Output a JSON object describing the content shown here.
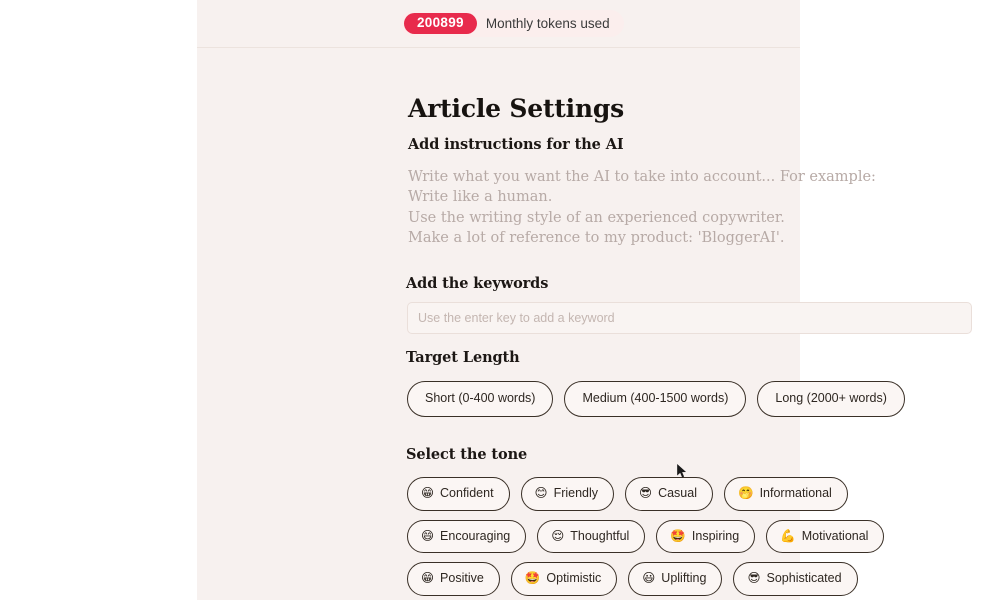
{
  "topbar": {
    "token_count": "200899",
    "token_label": "Monthly tokens used"
  },
  "page": {
    "title": "Article Settings"
  },
  "instructions": {
    "heading": "Add instructions for the AI",
    "placeholder_lines": [
      "Write what you want the AI to take into account... For example:",
      "Write like a human.",
      "Use the writing style of an experienced copywriter.",
      "Make a lot of reference to my product: 'BloggerAI'."
    ]
  },
  "keywords": {
    "heading": "Add the keywords",
    "placeholder": "Use the enter key to add a keyword",
    "value": ""
  },
  "target_length": {
    "heading": "Target Length",
    "options": [
      {
        "label": "Short (0-400 words)"
      },
      {
        "label": "Medium (400-1500 words)"
      },
      {
        "label": "Long (2000+ words)"
      }
    ]
  },
  "tone": {
    "heading": "Select the tone",
    "rows": [
      [
        {
          "emoji": "😁",
          "label": "Confident",
          "icon": "grinning-face-icon"
        },
        {
          "emoji": "😊",
          "label": "Friendly",
          "icon": "smiling-face-icon"
        },
        {
          "emoji": "😎",
          "label": "Casual",
          "icon": "sunglasses-face-icon"
        },
        {
          "emoji": "🤭",
          "label": "Informational",
          "icon": "hand-over-mouth-face-icon"
        }
      ],
      [
        {
          "emoji": "😄",
          "label": "Encouraging",
          "icon": "grinning-face-icon"
        },
        {
          "emoji": "😌",
          "label": "Thoughtful",
          "icon": "relieved-face-icon"
        },
        {
          "emoji": "🤩",
          "label": "Inspiring",
          "icon": "star-struck-face-icon"
        },
        {
          "emoji": "💪",
          "label": "Motivational",
          "icon": "flexed-biceps-icon"
        }
      ],
      [
        {
          "emoji": "😁",
          "label": "Positive",
          "icon": "grinning-face-icon"
        },
        {
          "emoji": "🤩",
          "label": "Optimistic",
          "icon": "star-struck-face-icon"
        },
        {
          "emoji": "😃",
          "label": "Uplifting",
          "icon": "grinning-face-big-eyes-icon"
        },
        {
          "emoji": "😎",
          "label": "Sophisticated",
          "icon": "sunglasses-face-icon"
        }
      ]
    ]
  },
  "colors": {
    "panel_bg": "#f7f1ef",
    "badge_red": "#e82a4c",
    "badge_container": "#fbeeed",
    "chip_border": "#3a3027",
    "placeholder_text": "#b7aaa6"
  }
}
